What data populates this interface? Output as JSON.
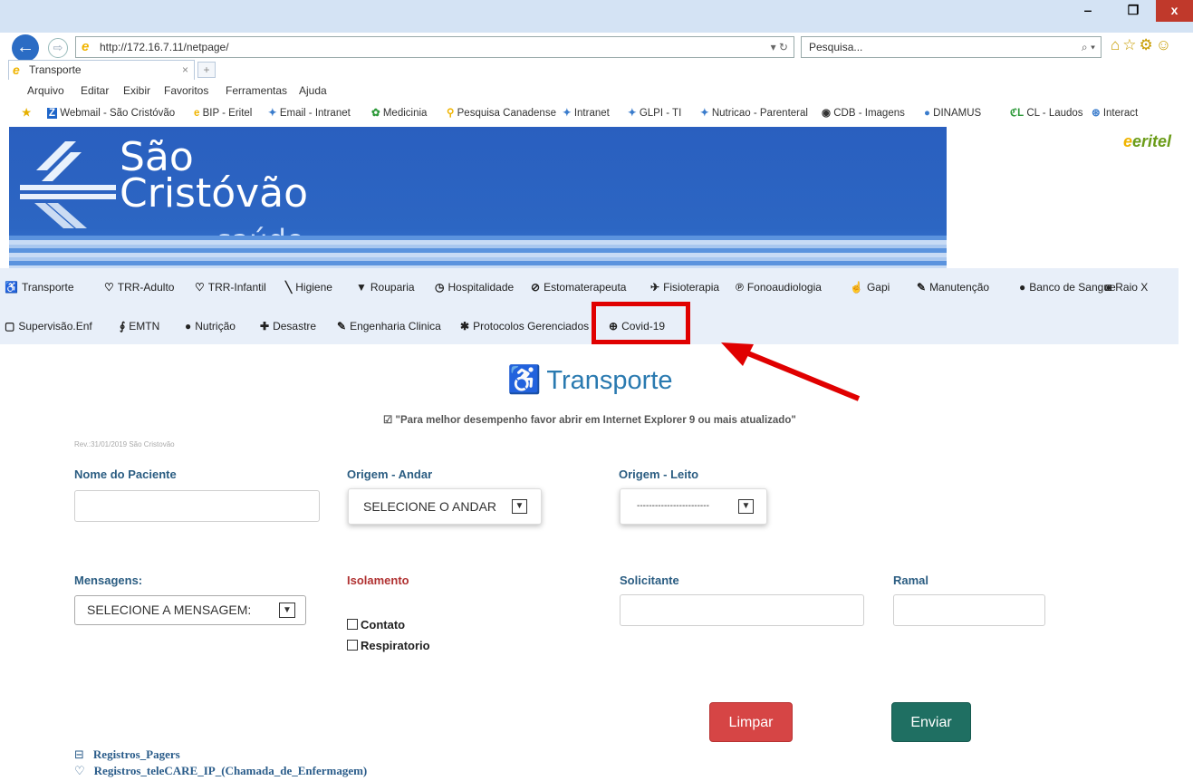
{
  "window": {
    "minimize": "‒",
    "restore": "❐",
    "close": "x"
  },
  "browser": {
    "url": "http://172.16.7.11/netpage/",
    "search_placeholder": "Pesquisa...",
    "tab_title": "Transporte",
    "menu": [
      "Arquivo",
      "Editar",
      "Exibir",
      "Favoritos",
      "Ferramentas",
      "Ajuda"
    ],
    "favorites": [
      "Webmail - São Cristóvão",
      "BIP - Eritel",
      "Email - Intranet",
      "Medicinia",
      "Pesquisa Canadense",
      "Intranet",
      "GLPI - TI",
      "Nutricao - Parenteral",
      "CDB - Imagens",
      "DINAMUS",
      "CL - Laudos",
      "Interact"
    ]
  },
  "banner": {
    "line1": "São",
    "line2": "Cristóvão",
    "line3": "saúde",
    "partner": "eritel"
  },
  "nav": {
    "row1": [
      "Transporte",
      "TRR-Adulto",
      "TRR-Infantil",
      "Higiene",
      "Rouparia",
      "Hospitalidade",
      "Estomaterapeuta",
      "Fisioterapia",
      "Fonoaudiologia",
      "Gapi",
      "Manutenção",
      "Banco de Sangue",
      "Raio X"
    ],
    "row2": [
      "Supervisão.Enf",
      "EMTN",
      "Nutrição",
      "Desastre",
      "Engenharia Clinica",
      "Protocolos Gerenciados",
      "Covid-19"
    ]
  },
  "page": {
    "title": "Transporte",
    "notice": "\"Para melhor desempenho favor abrir em Internet Explorer 9 ou mais atualizado\"",
    "revision": "Rev.:31/01/2019 São Cristovão"
  },
  "form": {
    "patient_label": "Nome do Paciente",
    "patient_value": "",
    "floor_label": "Origem - Andar",
    "floor_value": "SELECIONE O ANDAR",
    "bed_label": "Origem - Leito",
    "bed_value": "------------------------",
    "messages_label": "Mensagens:",
    "messages_value": "SELECIONE A MENSAGEM:",
    "isolation_label": "Isolamento",
    "contact_label": "Contato",
    "respiratory_label": "Respiratorio",
    "requester_label": "Solicitante",
    "requester_value": "",
    "extension_label": "Ramal",
    "extension_value": "",
    "clear_button": "Limpar",
    "send_button": "Enviar"
  },
  "links": [
    "Registros_Pagers",
    "Registros_teleCARE_IP_(Chamada_de_Enfermagem)"
  ],
  "colors": {
    "accent": "#2a7ab0",
    "highlight": "#e00000",
    "clear": "#d64545",
    "send": "#1f6f62"
  }
}
